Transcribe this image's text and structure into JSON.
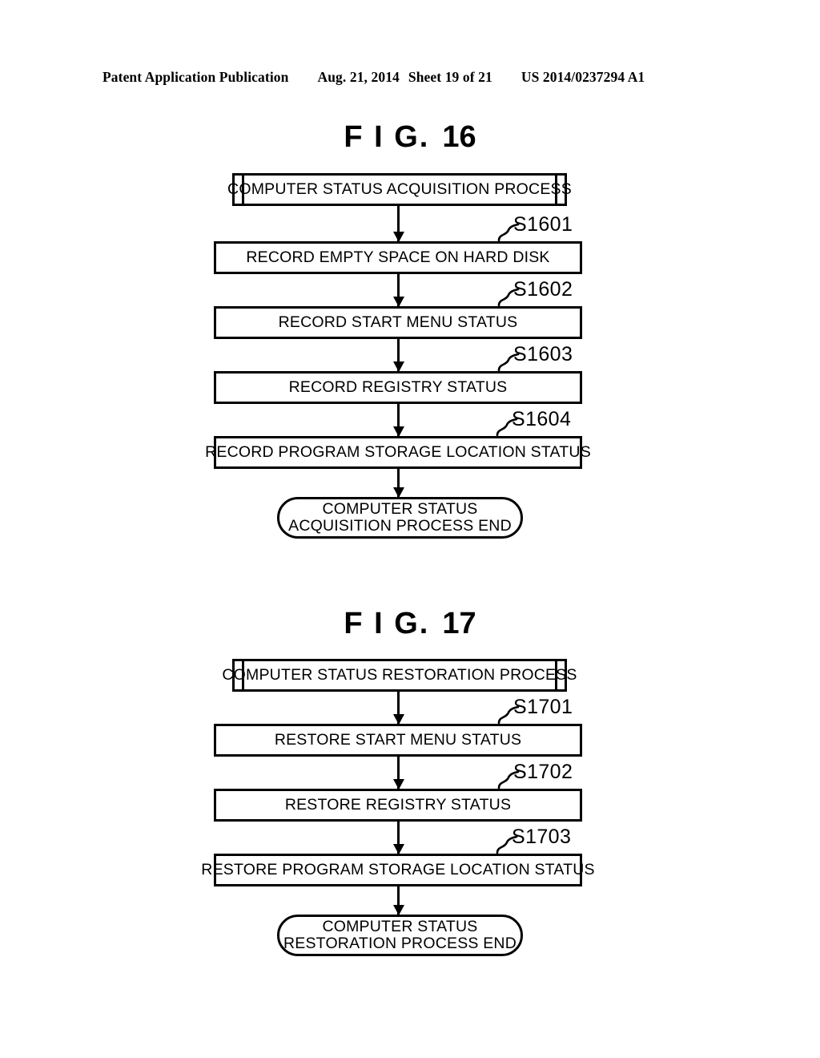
{
  "header": {
    "publication": "Patent Application Publication",
    "date": "Aug. 21, 2014",
    "sheet": "Sheet 19 of 21",
    "document_number": "US 2014/0237294 A1"
  },
  "figures": [
    {
      "title_prefix": "F I G.",
      "title_number": "16",
      "start": "COMPUTER STATUS ACQUISITION PROCESS",
      "steps": [
        {
          "id": "S1601",
          "text": "RECORD EMPTY SPACE ON HARD DISK"
        },
        {
          "id": "S1602",
          "text": "RECORD START MENU STATUS"
        },
        {
          "id": "S1603",
          "text": "RECORD REGISTRY STATUS"
        },
        {
          "id": "S1604",
          "text": "RECORD PROGRAM STORAGE LOCATION STATUS"
        }
      ],
      "end_line1": "COMPUTER STATUS",
      "end_line2": "ACQUISITION PROCESS END"
    },
    {
      "title_prefix": "F I G.",
      "title_number": "17",
      "start": "COMPUTER STATUS RESTORATION PROCESS",
      "steps": [
        {
          "id": "S1701",
          "text": "RESTORE START MENU STATUS"
        },
        {
          "id": "S1702",
          "text": "RESTORE REGISTRY STATUS"
        },
        {
          "id": "S1703",
          "text": "RESTORE PROGRAM STORAGE LOCATION STATUS"
        }
      ],
      "end_line1": "COMPUTER STATUS",
      "end_line2": "RESTORATION PROCESS END"
    }
  ],
  "style": {
    "ink": "#000000",
    "paper": "#ffffff"
  }
}
